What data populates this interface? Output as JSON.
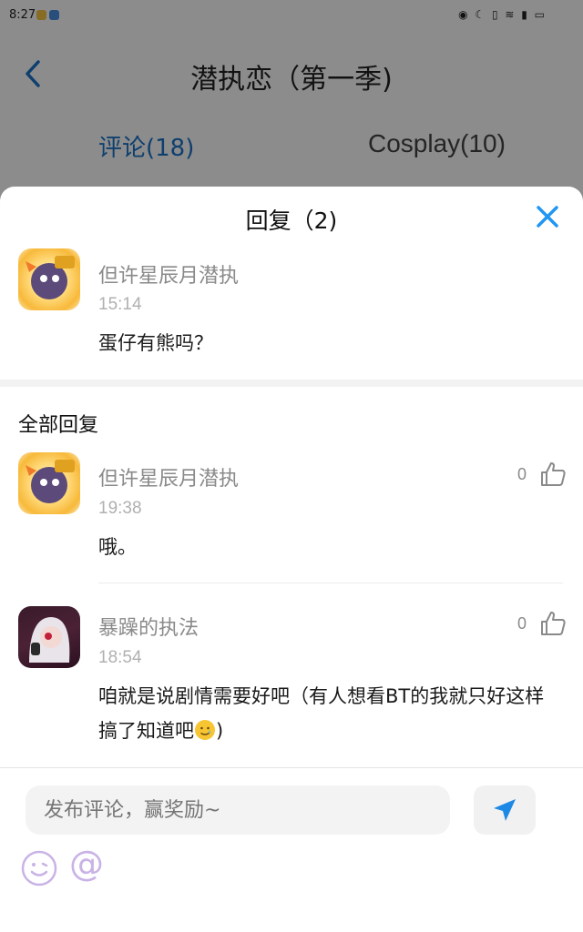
{
  "status_bar": {
    "time": "8:27",
    "right_glyphs": "◉ ☾ ▯ ≋ ▮ ▭"
  },
  "nav": {
    "title": "潜执恋（第一季)"
  },
  "tabs": [
    {
      "label": "评论(18)",
      "active": true
    },
    {
      "label": "Cosplay(10)",
      "active": false
    }
  ],
  "sheet": {
    "title": "回复（2)",
    "original_comment": {
      "author": "但许星辰月潜执",
      "time": "15:14",
      "text": "蛋仔有熊吗？"
    },
    "section_title": "全部回复",
    "replies": [
      {
        "author": "但许星辰月潜执",
        "time": "19:38",
        "text": "哦。",
        "likes": "0"
      },
      {
        "author": "暴躁的执法",
        "time": "18:54",
        "text": "咱就是说剧情需要好吧（有人想看BT的我就只好这样搞了知道吧",
        "text_suffix": ")",
        "likes": "0"
      }
    ]
  },
  "input": {
    "placeholder": "发布评论，赢奖励~"
  },
  "colors": {
    "accent": "#1a73c8",
    "close_icon": "#2196f3",
    "send_icon": "#1e88e5",
    "emoji_icon": "#c9b3e6"
  }
}
